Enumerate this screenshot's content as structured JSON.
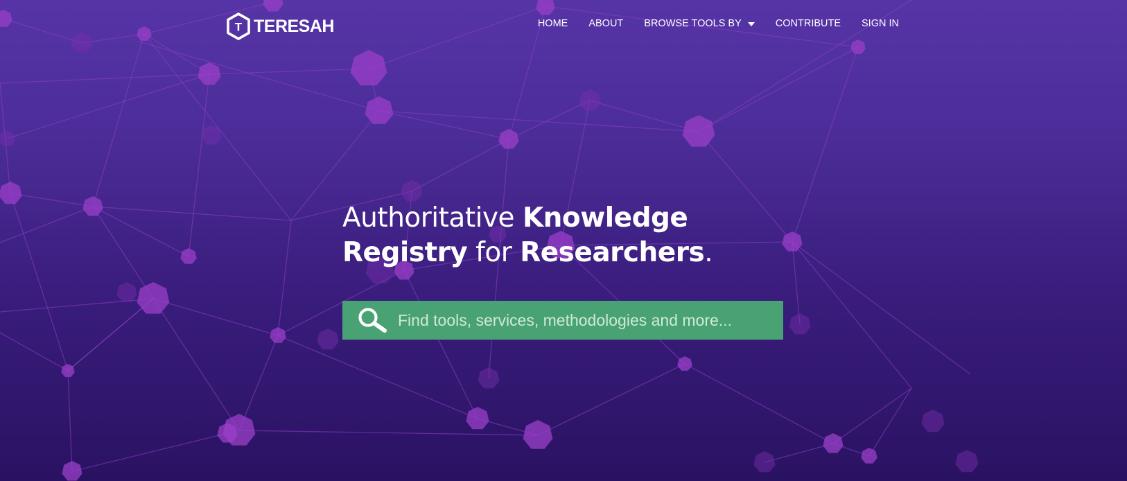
{
  "brand": {
    "name": "TERESAH",
    "logo_letter": "T"
  },
  "nav": {
    "items": [
      {
        "label": "HOME"
      },
      {
        "label": "ABOUT"
      },
      {
        "label": "BROWSE TOOLS BY",
        "has_dropdown": true
      },
      {
        "label": "CONTRIBUTE"
      },
      {
        "label": "SIGN IN"
      }
    ]
  },
  "hero": {
    "line1_light": "Authoritative ",
    "line1_bold": "Knowledge",
    "line2_bold_a": "Registry",
    "line2_light": " for ",
    "line2_bold_b": "Researchers",
    "line2_end": "."
  },
  "search": {
    "placeholder": "Find tools, services, methodologies and more...",
    "value": "",
    "icon": "search-icon"
  },
  "colors": {
    "background_top": "#5634a6",
    "background_bottom": "#2a1262",
    "network_node": "#9b3fc8",
    "search_bar": "#48a273",
    "text": "#ffffff"
  }
}
